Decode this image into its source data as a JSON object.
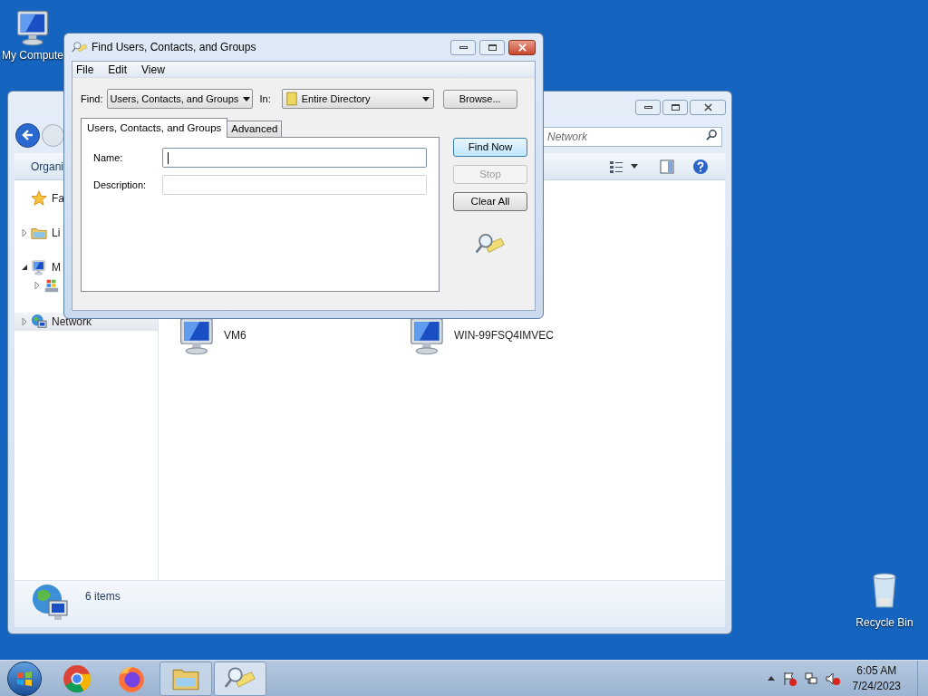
{
  "desktop_icons": [
    {
      "kind": "computer",
      "label": "My Compute"
    },
    {
      "kind": "recycle-bin",
      "label": "Recycle Bin"
    }
  ],
  "explorer": {
    "search": {
      "placeholder": "Network"
    },
    "toolbar": {
      "organize": "Organi"
    },
    "sidebar": {
      "items": [
        {
          "kind": "favorites",
          "label": "Fa",
          "selected": false
        },
        {
          "kind": "libraries",
          "label": "Li",
          "expanded": false,
          "selected": false
        },
        {
          "kind": "computer",
          "label": "M",
          "expanded": true,
          "selected": false,
          "children": [
            {
              "kind": "drive",
              "expanded": false,
              "selected": false
            }
          ]
        },
        {
          "kind": "network",
          "label": "Network",
          "expanded": false,
          "selected": true
        }
      ]
    },
    "items": [
      {
        "label": "VM6"
      },
      {
        "label": "WIN-99FSQ4IMVEC"
      }
    ],
    "status": "6 items"
  },
  "dialog": {
    "title": "Find Users, Contacts, and Groups",
    "menu": [
      "File",
      "Edit",
      "View"
    ],
    "find_label": "Find:",
    "find_value": "Users, Contacts, and Groups",
    "in_label": "In:",
    "in_value": "Entire Directory",
    "browse": "Browse...",
    "tabs": [
      {
        "label": "Users, Contacts, and Groups",
        "selected": true
      },
      {
        "label": "Advanced",
        "selected": false
      }
    ],
    "fields": [
      {
        "label": "Name:",
        "focused": true
      },
      {
        "label": "Description:",
        "focused": false
      }
    ],
    "buttons": [
      {
        "label": "Find Now",
        "default": true,
        "disabled": false
      },
      {
        "label": "Stop",
        "default": false,
        "disabled": true
      },
      {
        "label": "Clear All",
        "default": false,
        "disabled": false
      }
    ]
  },
  "taskbar": {
    "apps": [
      {
        "kind": "chrome",
        "running": false,
        "active": false
      },
      {
        "kind": "firefox",
        "running": false,
        "active": false
      },
      {
        "kind": "explorer",
        "running": true,
        "active": false
      },
      {
        "kind": "find",
        "running": true,
        "active": true
      }
    ],
    "time": "6:05 AM",
    "date": "7/24/2023"
  }
}
